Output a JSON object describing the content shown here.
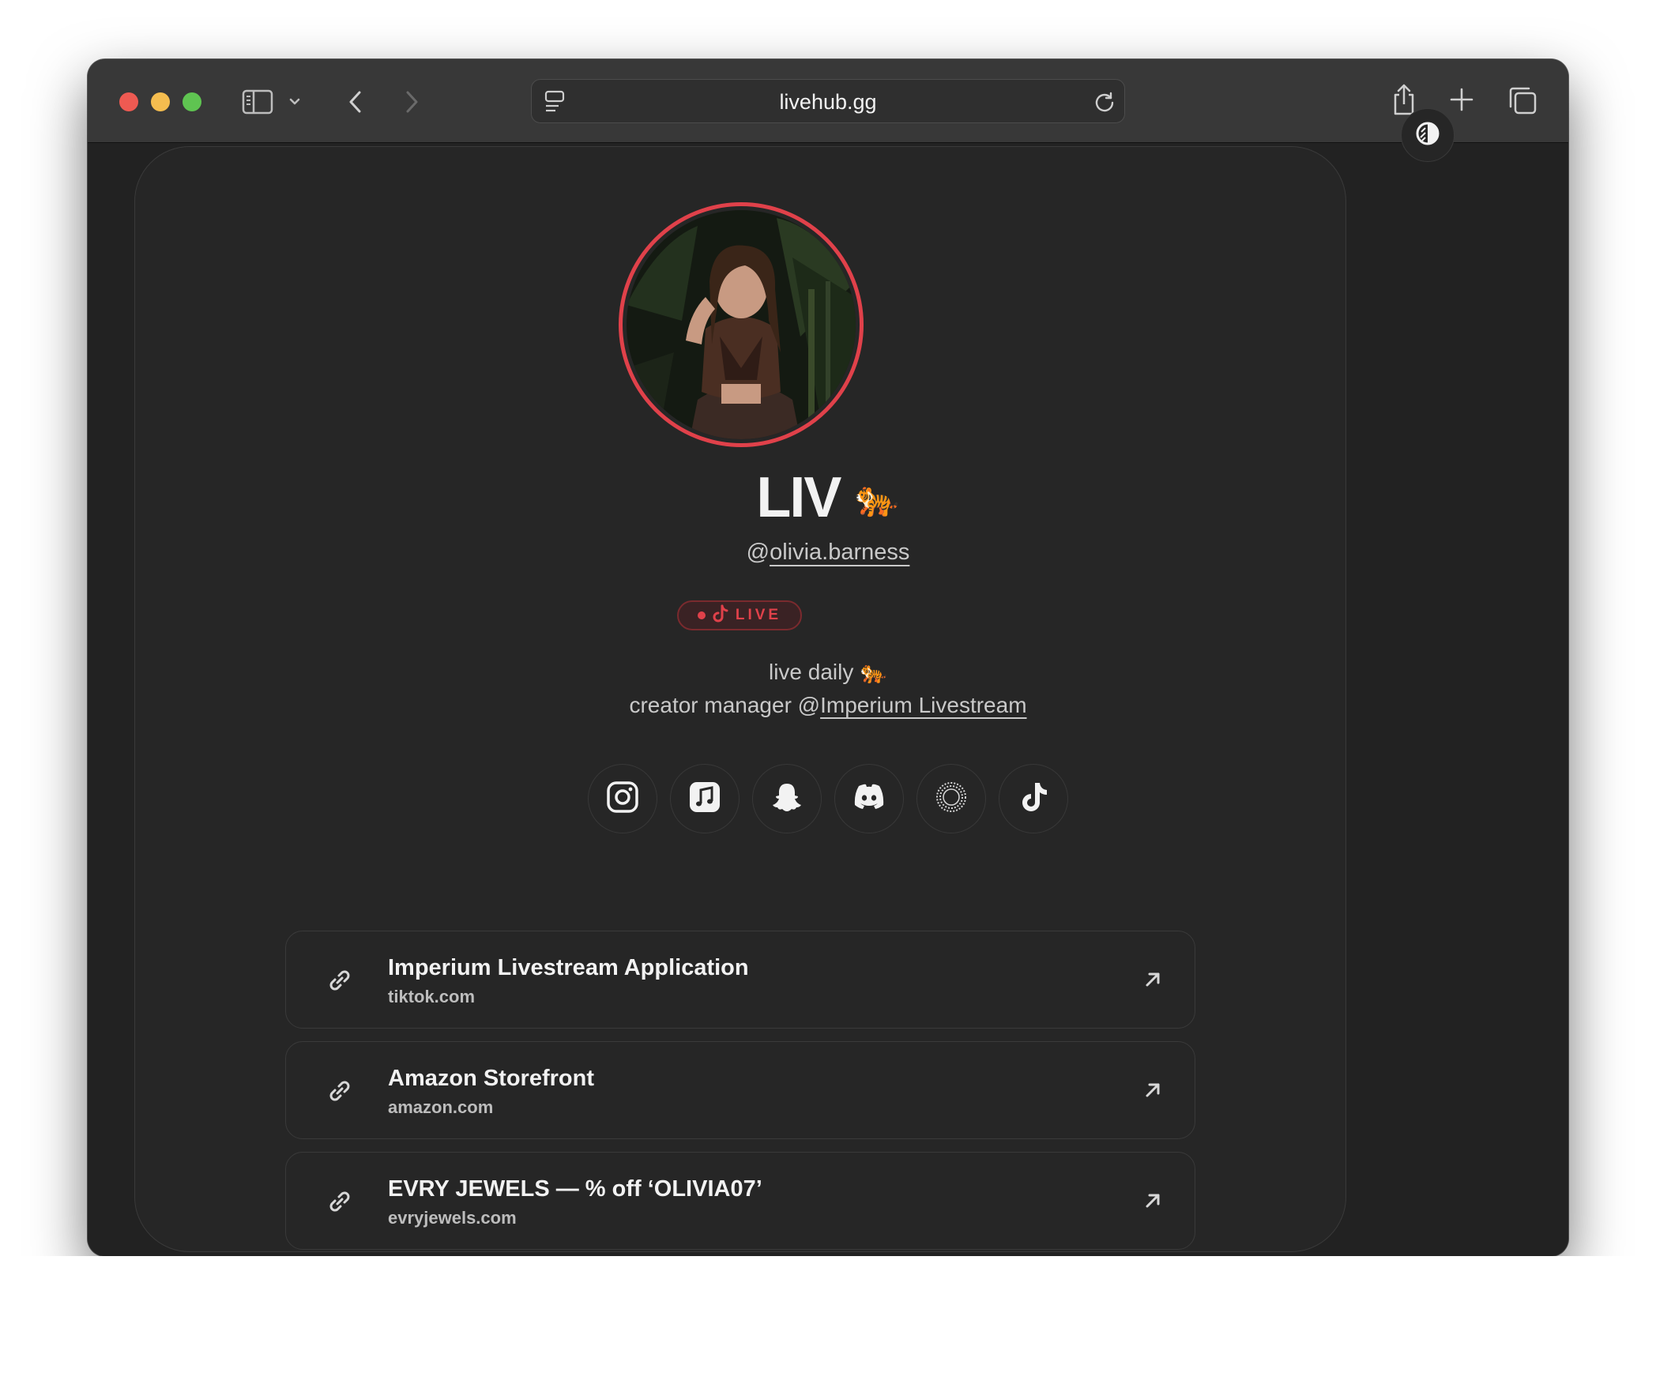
{
  "browser": {
    "url": "livehub.gg"
  },
  "profile": {
    "name": "LIV",
    "name_emoji": "🐅",
    "handle_prefix": "@",
    "handle": "olivia.barness",
    "live_label": "LIVE",
    "bio_line1": "live daily 🐅",
    "bio_line2_prefix": "creator manager @",
    "bio_line2_link": "Imperium Livestream"
  },
  "socials": [
    {
      "name": "instagram-icon"
    },
    {
      "name": "apple-music-icon"
    },
    {
      "name": "snapchat-icon"
    },
    {
      "name": "discord-icon"
    },
    {
      "name": "threads-icon"
    },
    {
      "name": "tiktok-icon"
    }
  ],
  "links": [
    {
      "title": "Imperium Livestream Application",
      "domain": "tiktok.com"
    },
    {
      "title": "Amazon Storefront",
      "domain": "amazon.com"
    },
    {
      "title": "EVRY JEWELS — % off ‘OLIVIA07’",
      "domain": "evryjewels.com"
    }
  ],
  "colors": {
    "accent_live": "#e0414a",
    "page_bg": "#222222",
    "card_bg": "#262626"
  }
}
